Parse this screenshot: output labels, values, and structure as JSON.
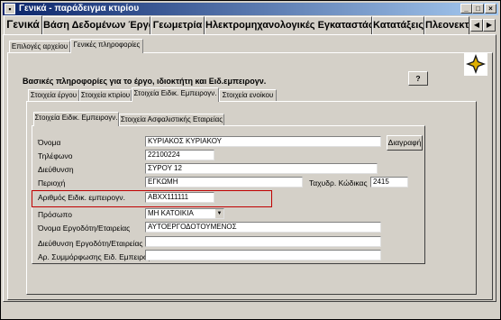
{
  "window": {
    "title": "Γενικά - παράδειγμα κτιρίου",
    "icon": "window-icon"
  },
  "top_tabs": [
    {
      "label": "Γενικά",
      "active": true
    },
    {
      "label": "Βάση Δεδομένων Έργου",
      "active": false
    },
    {
      "label": "Γεωμετρία",
      "active": false
    },
    {
      "label": "Ηλεκτρομηχανολογικές Εγκαταστάσεις",
      "active": false
    },
    {
      "label": "Κατατάξεις",
      "active": false
    },
    {
      "label": "Πλεονεκτ",
      "active": false
    }
  ],
  "sub_tabs": [
    {
      "label": "Επιλογές αρχείου",
      "active": false
    },
    {
      "label": "Γενικές πληροφορίες",
      "active": true
    }
  ],
  "heading": "Βασικές πληροφορίες για το έργο, ιδιοκτήτη και Ειδ.εμπειρογν.",
  "help_button": "?",
  "info_tabs": [
    {
      "label": "Στοιχεία έργου",
      "active": false
    },
    {
      "label": "Στοιχεία κτιρίου",
      "active": false
    },
    {
      "label": "Στοιχεία Ειδικ. Εμπειρογν.",
      "active": true
    },
    {
      "label": "Στοιχεία ενοίκου",
      "active": false
    }
  ],
  "inner_tabs": [
    {
      "label": "Στοιχεία Ειδικ. Εμπειρογν.",
      "active": true
    },
    {
      "label": "Στοιχεία Ασφαλιστικής Εταιρείας",
      "active": false
    }
  ],
  "form": {
    "name_label": "Όνομα",
    "name_value": "ΚΥΡΙΑΚΟΣ ΚΥΡΙΑΚΟΥ",
    "phone_label": "Τηλέφωνο",
    "phone_value": "22100224",
    "address_label": "Διεύθυνση",
    "address_value": "ΣΥΡΟΥ 12",
    "region_label": "Περιοχή",
    "region_value": "ΕΓΚΩΜΗ",
    "postcode_label": "Ταχυδρ. Κώδικας",
    "postcode_value": "2415",
    "expert_no_label": "Αριθμός Ειδικ. εμπειρογν.",
    "expert_no_value": "ΑΒΧΧ111111",
    "person_label": "Πρόσωπο",
    "person_value": "ΜΗ ΚΑΤΟΙΚΙΑ",
    "employer_name_label": "Όνομα Εργοδότη/Εταιρείας",
    "employer_name_value": "ΑΥΤΟΕΡΓΟΔΟΤΟΥΜΕΝΟΣ",
    "employer_address_label": "Διεύθυνση Εργοδότη/Εταιρείας",
    "employer_address_value": "",
    "compliance_no_label": "Αρ. Συμμόρφωσης Ειδ. Εμπειρογν.",
    "compliance_no_value": ""
  },
  "delete_button": "Διαγραφή",
  "colors": {
    "title_start": "#0a246a",
    "title_end": "#a6caf0",
    "face": "#d4d0c8",
    "highlight": "#c00000"
  }
}
